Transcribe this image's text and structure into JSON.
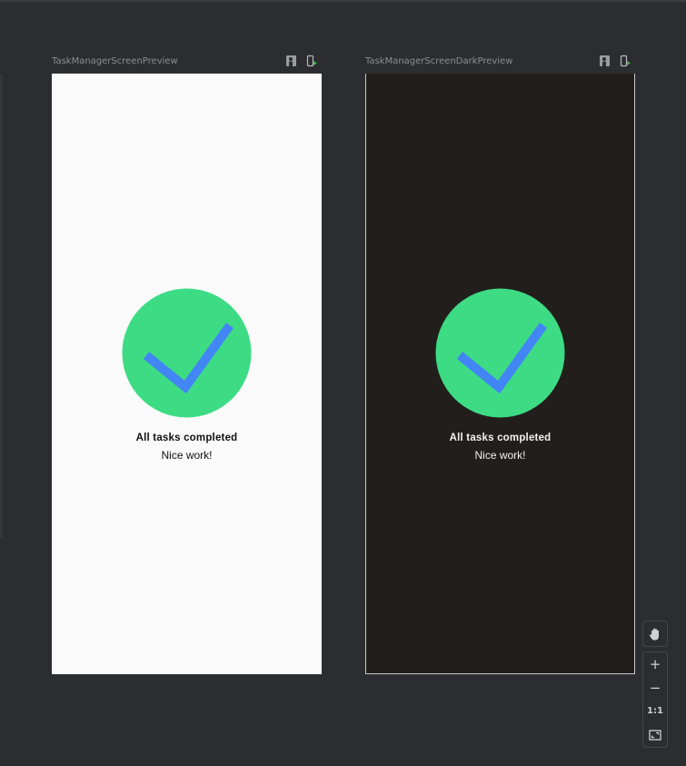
{
  "previews": [
    {
      "title": "TaskManagerScreenPreview",
      "theme": "light",
      "background": "#fafafa",
      "empty_state": {
        "title": "All tasks completed",
        "subtitle": "Nice work!",
        "icon": "check-circle-icon"
      }
    },
    {
      "title": "TaskManagerScreenDarkPreview",
      "theme": "dark",
      "background": "#211e1b",
      "empty_state": {
        "title": "All tasks completed",
        "subtitle": "Nice work!",
        "icon": "check-circle-icon"
      }
    }
  ],
  "header_icons": [
    "interactive-mode-icon",
    "deploy-to-device-icon"
  ],
  "zoom_controls": {
    "pan": "hand-icon",
    "zoom_in": "+",
    "zoom_out": "−",
    "actual_size": "1:1",
    "zoom_to_fit": "zoom-to-fit-icon"
  },
  "colors": {
    "check_circle": "#3ddc84",
    "check_mark": "#4285f4",
    "ide_background": "#2b2d30"
  }
}
